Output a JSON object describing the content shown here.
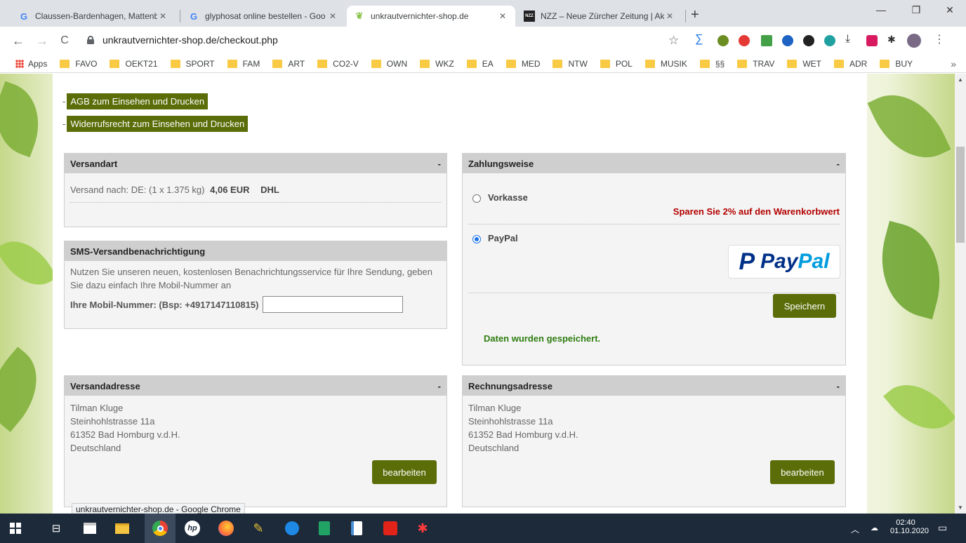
{
  "tabs": [
    {
      "title": "Claussen-Bardenhagen, Mattenb",
      "icon": "google-icon"
    },
    {
      "title": "glyphosat online bestellen - Goo",
      "icon": "google-icon"
    },
    {
      "title": "unkrautvernichter-shop.de",
      "icon": "leaf-icon",
      "active": true
    },
    {
      "title": "NZZ – Neue Zürcher Zeitung | Ak",
      "icon": "nzz-icon",
      "favicon_text": "NZZ"
    }
  ],
  "toolbar": {
    "url": "unkrautvernichter-shop.de/checkout.php"
  },
  "bookmarks": {
    "apps_label": "Apps",
    "items": [
      "FAVO",
      "OEKT21",
      "SPORT",
      "FAM",
      "ART",
      "CO2-V",
      "OWN",
      "WKZ",
      "EA",
      "MED",
      "NTW",
      "POL",
      "MUSIK",
      "§§",
      "TRAV",
      "WET",
      "ADR",
      "BUY"
    ],
    "more": "»"
  },
  "links": {
    "dash": "-",
    "agb": "AGB zum Einsehen und Drucken",
    "widerruf": "Widerrufsrecht zum Einsehen und Drucken"
  },
  "versandart": {
    "title": "Versandart",
    "toggle": "-",
    "text": "Versand nach: DE: (1 x 1.375 kg)",
    "price": "4,06 EUR",
    "carrier": "DHL"
  },
  "sms": {
    "title": "SMS-Versandbenachrichtigung",
    "text": "Nutzen Sie unseren neuen, kostenlosen Benachrichtungsservice für Ihre Sendung, geben Sie dazu einfach Ihre Mobil-Nummer an",
    "label": "Ihre Mobil-Nummer: (Bsp: +4917147110815)",
    "value": ""
  },
  "zahlung": {
    "title": "Zahlungsweise",
    "toggle": "-",
    "vorkasse": "Vorkasse",
    "discount": "Sparen Sie 2% auf den Warenkorbwert",
    "paypal": "PayPal",
    "paypal_logo_a": "Pay",
    "paypal_logo_b": "Pal",
    "save": "Speichern",
    "saved_msg": "Daten wurden gespeichert."
  },
  "versandadresse": {
    "title": "Versandadresse",
    "toggle": "-",
    "name": "Tilman Kluge",
    "street": "Steinhohlstrasse 11a",
    "city": "61352 Bad Homburg v.d.H.",
    "country": "Deutschland",
    "edit": "bearbeiten"
  },
  "rechnungsadresse": {
    "title": "Rechnungsadresse",
    "toggle": "-",
    "name": "Tilman Kluge",
    "street": "Steinhohlstrasse 11a",
    "city": "61352 Bad Homburg v.d.H.",
    "country": "Deutschland",
    "edit": "bearbeiten"
  },
  "status_tooltip": "unkrautvernichter-shop.de - Google Chrome",
  "taskbar": {
    "time": "02:40",
    "date": "01.10.2020"
  },
  "colors": {
    "shop_green": "#5a6d09",
    "discount_red": "#b30000",
    "saved_green": "#2e7d10",
    "panel_header": "#cfcfcf"
  }
}
